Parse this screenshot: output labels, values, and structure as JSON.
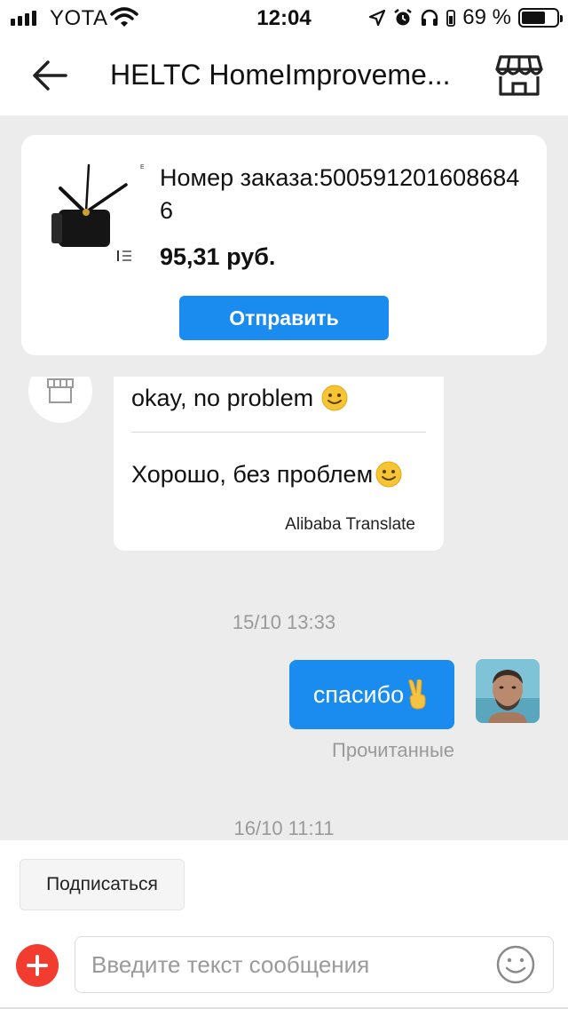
{
  "status_bar": {
    "carrier": "YOTA",
    "time": "12:04",
    "battery_percent": "69 %",
    "battery_level": 0.69,
    "icons": [
      "signal-icon",
      "wifi-icon",
      "location-icon",
      "alarm-icon",
      "headphones-icon",
      "battery-icon"
    ]
  },
  "header": {
    "title": "HELTC HomeImproveme..."
  },
  "product": {
    "order_label": "Номер заказа:5005912016086846",
    "price": "95,31 руб.",
    "send_button": "Отправить"
  },
  "messages": {
    "incoming_original": "okay, no problem",
    "incoming_translated": "Хорошо, без проблем",
    "translate_source": "Alibaba Translate",
    "timestamp_1": "15/10 13:33",
    "outgoing_text": "спасибо",
    "read_status": "Прочитанные",
    "timestamp_2": "16/10 11:11"
  },
  "bottom": {
    "subscribe_label": "Подписаться",
    "input_placeholder": "Введите текст сообщения"
  },
  "colors": {
    "accent": "#1a8cf0",
    "plus_button": "#f23c30",
    "background": "#ececec",
    "muted_text": "#9a9a9a"
  }
}
